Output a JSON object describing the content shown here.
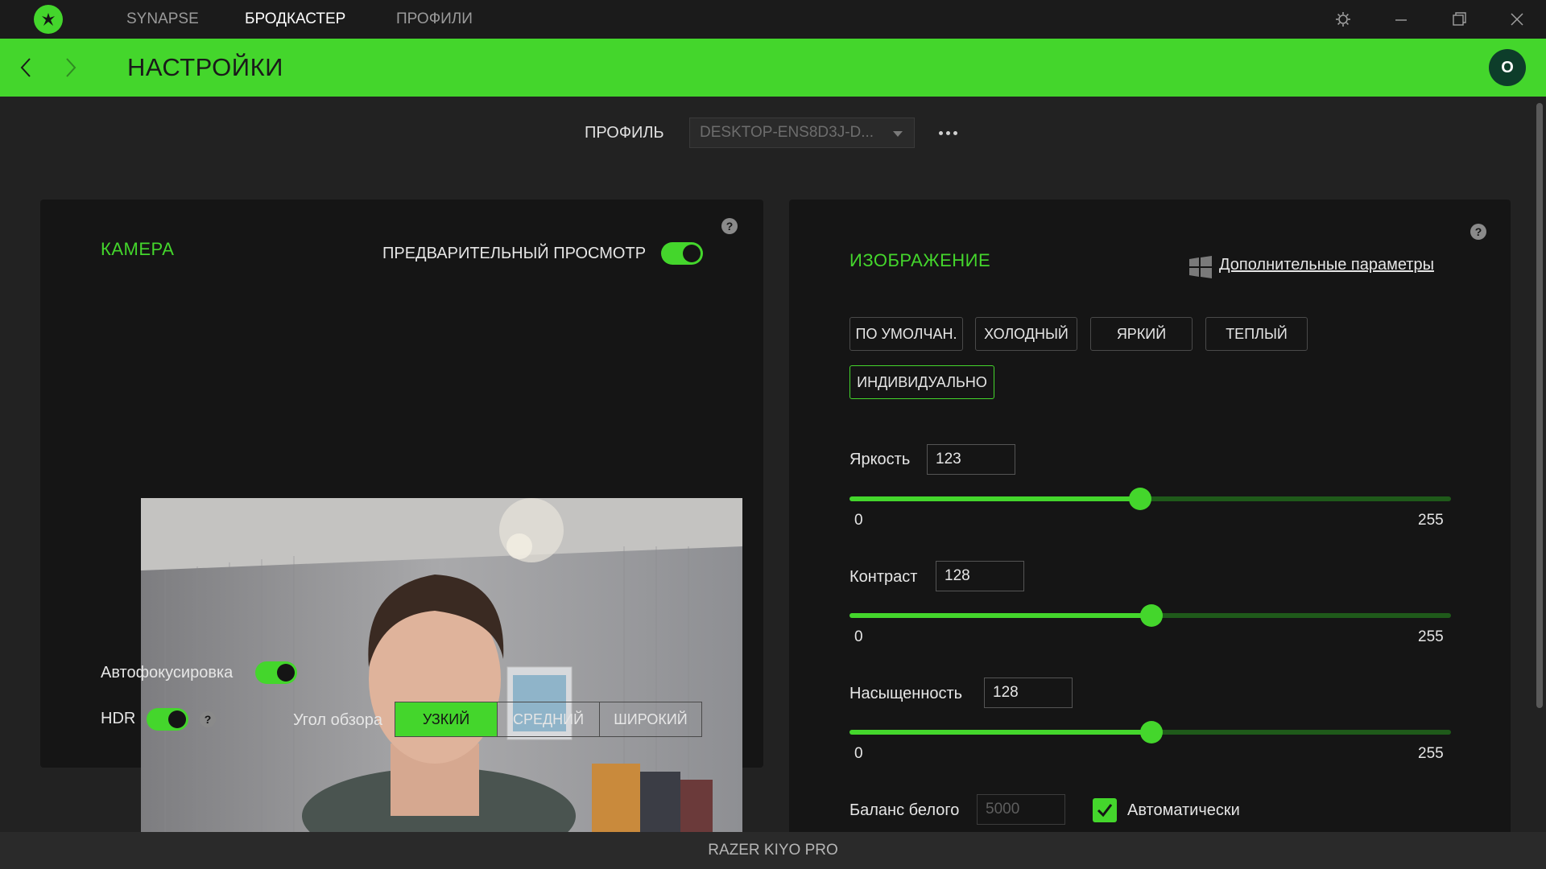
{
  "titlebar": {
    "tabs": [
      "SYNAPSE",
      "БРОДКАСТЕР",
      "ПРОФИЛИ"
    ],
    "active_tab": "БРОДКАСТЕР"
  },
  "header": {
    "title": "НАСТРОЙКИ",
    "avatar_initial": "O"
  },
  "profile": {
    "label": "ПРОФИЛЬ",
    "selected": "DESKTOP-ENS8D3J-D..."
  },
  "camera": {
    "title": "КАМЕРА",
    "preview_label": "ПРЕДВАРИТЕЛЬНЫЙ ПРОСМОТР",
    "autofocus_label": "Автофокусировка",
    "hdr_label": "HDR",
    "fov_label": "Угол обзора",
    "fov_options": [
      "УЗКИЙ",
      "СРЕДНИЙ",
      "ШИРОКИЙ"
    ],
    "fov_selected": "УЗКИЙ"
  },
  "image": {
    "title": "ИЗОБРАЖЕНИЕ",
    "advanced_link": "Дополнительные параметры",
    "presets": [
      "ПО УМОЛЧАН.",
      "ХОЛОДНЫЙ",
      "ЯРКИЙ",
      "ТЕПЛЫЙ",
      "ИНДИВИДУАЛЬНО"
    ],
    "preset_selected": "ИНДИВИДУАЛЬНО",
    "sliders": [
      {
        "label": "Яркость",
        "value": "123",
        "min": "0",
        "max": "255"
      },
      {
        "label": "Контраст",
        "value": "128",
        "min": "0",
        "max": "255"
      },
      {
        "label": "Насыщенность",
        "value": "128",
        "min": "0",
        "max": "255"
      }
    ],
    "white_balance_label": "Баланс белого",
    "white_balance_value": "5000",
    "auto_label": "Автоматически"
  },
  "footer": {
    "device": "RAZER KIYO PRO"
  },
  "colors": {
    "accent": "#44d62c",
    "background": "#222222",
    "panel": "#151515"
  }
}
